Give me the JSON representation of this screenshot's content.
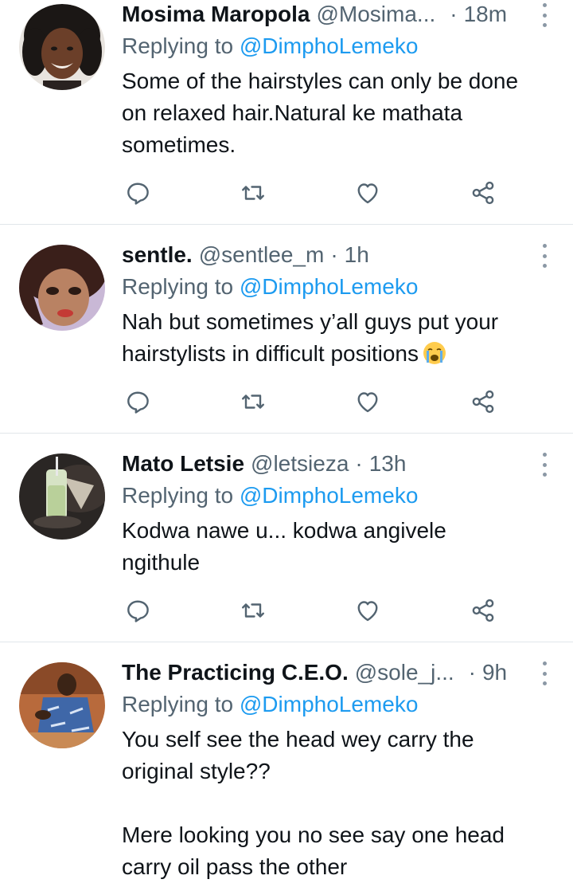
{
  "replying_label": "Replying to",
  "tweets": [
    {
      "name": "Mosima Maropola",
      "handle": "@Mosima...",
      "separator": "·",
      "time": "18m",
      "mention": "@DimphoLemeko",
      "lines": [
        "Some of the hairstyles can only be done",
        "on relaxed hair.Natural ke mathata",
        "sometimes."
      ]
    },
    {
      "name": "sentle.",
      "handle": "@sentlee_m",
      "separator": "·",
      "time": "1h",
      "mention": "@DimphoLemeko",
      "lines": [
        "Nah but sometimes y’all guys put your",
        "hairstylists in difficult positions"
      ],
      "emoji": "loudly-crying-face"
    },
    {
      "name": "Mato Letsie",
      "handle": "@letsieza",
      "separator": "·",
      "time": "13h",
      "mention": "@DimphoLemeko",
      "lines": [
        "Kodwa nawe u... kodwa angivele",
        "ngithule"
      ]
    },
    {
      "name": "The Practicing C.E.O.",
      "handle": "@sole_j...",
      "separator": "·",
      "time": "9h",
      "mention": "@DimphoLemeko",
      "lines": [
        "You self see the head wey carry the",
        "original style??",
        "",
        "Mere looking you no see say one head",
        "carry oil pass the other"
      ]
    }
  ],
  "icons": {
    "reply": "reply-icon",
    "retweet": "retweet-icon",
    "like": "heart-icon",
    "share": "share-icon",
    "more": "more-options-icon"
  },
  "colors": {
    "name": "#0f1419",
    "secondary": "#536471",
    "mention": "#1d9bf0",
    "divider": "#e1e6ea"
  }
}
